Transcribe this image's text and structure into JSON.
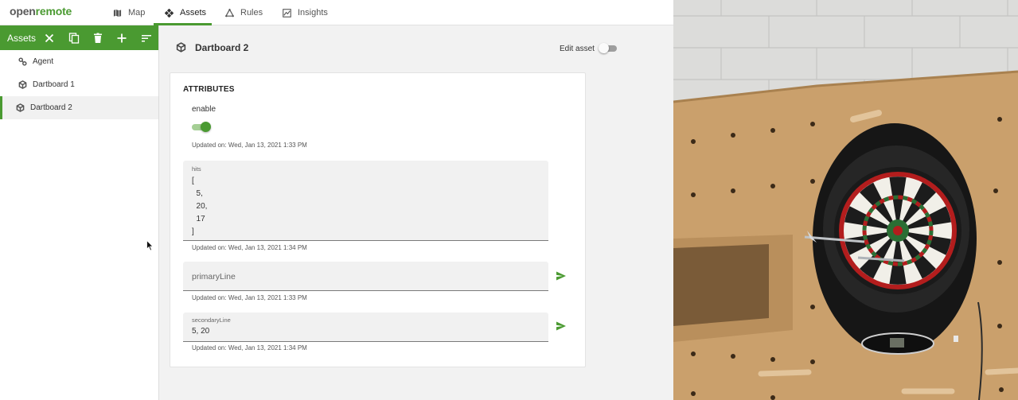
{
  "header": {
    "logo_open": "open",
    "logo_remote": "remote",
    "tabs": [
      {
        "label": "Map",
        "icon": "map-icon"
      },
      {
        "label": "Assets",
        "icon": "assets-icon"
      },
      {
        "label": "Rules",
        "icon": "rules-icon"
      },
      {
        "label": "Insights",
        "icon": "insights-icon"
      }
    ]
  },
  "sidebar": {
    "title": "Assets",
    "toolbar_icons": [
      "close-icon",
      "copy-icon",
      "delete-icon",
      "add-icon",
      "sort-icon"
    ],
    "items": [
      {
        "label": "Agent",
        "icon": "agent-icon"
      },
      {
        "label": "Dartboard 1",
        "icon": "cube-icon"
      },
      {
        "label": "Dartboard 2",
        "icon": "cube-icon",
        "selected": true
      }
    ]
  },
  "asset": {
    "title": "Dartboard 2",
    "edit_label": "Edit asset",
    "edit_enabled": false
  },
  "attributes": {
    "heading": "ATTRIBUTES",
    "enable": {
      "label": "enable",
      "value": true,
      "updated": "Updated on: Wed, Jan 13, 2021 1:33 PM"
    },
    "hits": {
      "label": "hits",
      "lines": [
        "[",
        "  5,",
        "  20,",
        "  17",
        "]"
      ],
      "updated": "Updated on: Wed, Jan 13, 2021 1:34 PM"
    },
    "primaryLine": {
      "placeholder": "primaryLine",
      "updated": "Updated on: Wed, Jan 13, 2021 1:33 PM"
    },
    "secondaryLine": {
      "label": "secondaryLine",
      "value": "5, 20",
      "updated": "Updated on: Wed, Jan 13, 2021 1:34 PM"
    }
  },
  "colors": {
    "accent": "#4a9a31",
    "toolbar_bg": "#4a9a31"
  }
}
